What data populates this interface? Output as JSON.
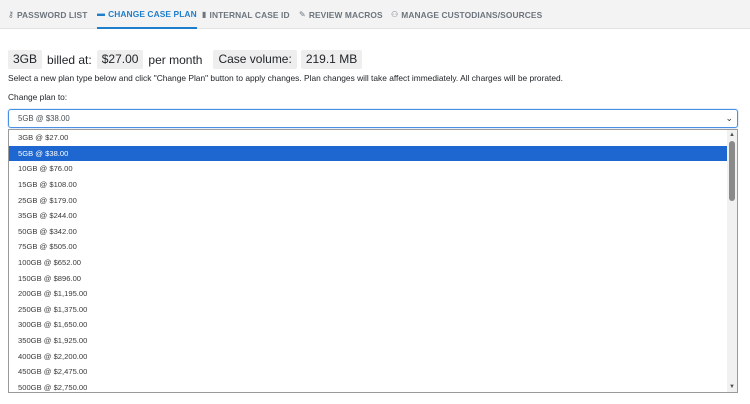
{
  "tabs": [
    {
      "label": "PASSWORD LIST",
      "icon": "key-icon",
      "glyph": "⚷"
    },
    {
      "label": "CHANGE CASE PLAN",
      "icon": "folder-icon",
      "glyph": "▬"
    },
    {
      "label": "INTERNAL CASE ID",
      "icon": "bookmark-icon",
      "glyph": "▮"
    },
    {
      "label": "REVIEW MACROS",
      "icon": "wand-icon",
      "glyph": "✎"
    },
    {
      "label": "MANAGE CUSTODIANS/SOURCES",
      "icon": "users-icon",
      "glyph": "⚇"
    }
  ],
  "active_tab": "CHANGE CASE PLAN",
  "info": {
    "plan": "3GB",
    "billed_label": "billed at:",
    "price": "$27.00",
    "per": "per month",
    "volume_label": "Case volume:",
    "volume": "219.1 MB"
  },
  "description": "Select a new plan type below and click \"Change Plan\" button to apply changes. Plan changes will take affect immediately. All charges will be prorated.",
  "change_label": "Change plan to:",
  "select": {
    "value": "5GB @ $38.00",
    "options": [
      "3GB @ $27.00",
      "5GB @ $38.00",
      "10GB @ $76.00",
      "15GB @ $108.00",
      "25GB @ $179.00",
      "35GB @ $244.00",
      "50GB @ $342.00",
      "75GB @ $505.00",
      "100GB @ $652.00",
      "150GB @ $896.00",
      "200GB @ $1,195.00",
      "250GB @ $1,375.00",
      "300GB @ $1,650.00",
      "350GB @ $1,925.00",
      "400GB @ $2,200.00",
      "450GB @ $2,475.00",
      "500GB @ $2,750.00"
    ],
    "selected_index": 1
  },
  "colors": {
    "accent": "#1f7ecb",
    "highlight": "#1e66d0"
  }
}
